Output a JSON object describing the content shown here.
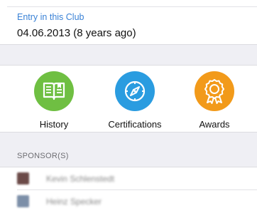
{
  "club_entry": {
    "label": "Entry in this Club",
    "value": "04.06.2013 (8 years ago)"
  },
  "actions": [
    {
      "label": "History",
      "icon": "book-icon",
      "color": "#6fbf42"
    },
    {
      "label": "Certifications",
      "icon": "compass-icon",
      "color": "#2a9ce0"
    },
    {
      "label": "Awards",
      "icon": "award-ribbon-icon",
      "color": "#f29a1a"
    }
  ],
  "sponsors": {
    "header": "SPONSOR(S)",
    "items": [
      {
        "name": "Kevin Schlenstedt",
        "avatar_color": "#6b4a48"
      },
      {
        "name": "Heinz Specker",
        "avatar_color": "#7c8fa8"
      }
    ]
  }
}
